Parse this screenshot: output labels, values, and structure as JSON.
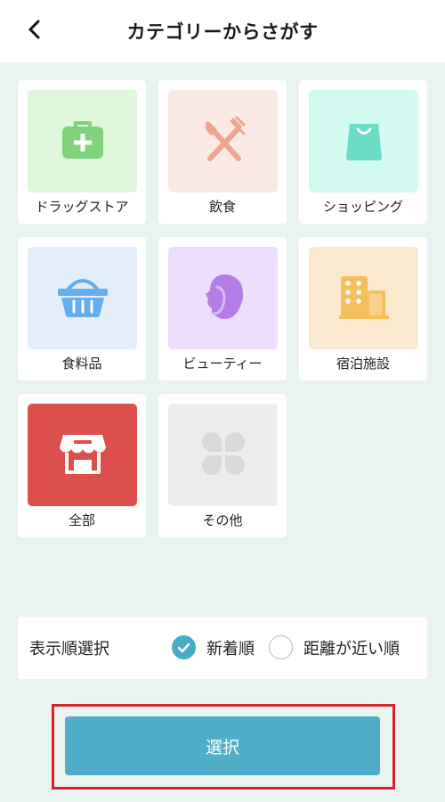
{
  "header": {
    "title": "カテゴリーからさがす",
    "back_icon": "chevron-left-icon"
  },
  "categories": [
    {
      "label": "ドラッグストア",
      "icon": "medical-kit-icon",
      "tile_color": "#dff8dc",
      "icon_color": "#7fd47b"
    },
    {
      "label": "飲食",
      "icon": "fork-knife-icon",
      "tile_color": "#fbe9e6",
      "icon_color": "#f0a490"
    },
    {
      "label": "ショッピング",
      "icon": "shopping-bag-icon",
      "tile_color": "#d3faf1",
      "icon_color": "#6bdcc6"
    },
    {
      "label": "食料品",
      "icon": "basket-icon",
      "tile_color": "#e4eefb",
      "icon_color": "#62aef0"
    },
    {
      "label": "ビューティー",
      "icon": "beauty-face-icon",
      "tile_color": "#ecdefc",
      "icon_color": "#b37ce6"
    },
    {
      "label": "宿泊施設",
      "icon": "hotel-building-icon",
      "tile_color": "#fbe9cf",
      "icon_color": "#f5bf5c"
    },
    {
      "label": "全部",
      "icon": "storefront-icon",
      "tile_color": "#dd4f4d",
      "icon_color": "#ffffff"
    },
    {
      "label": "その他",
      "icon": "four-petal-icon",
      "tile_color": "#ededed",
      "icon_color": "#d9d9d9"
    }
  ],
  "sort": {
    "label": "表示順選択",
    "options": [
      {
        "label": "新着順",
        "selected": true
      },
      {
        "label": "距離が近い順",
        "selected": false
      }
    ]
  },
  "select_button": {
    "label": "選択"
  },
  "colors": {
    "background": "#e9f3f0",
    "accent": "#4fadc8",
    "highlight_border": "#d6252c"
  }
}
